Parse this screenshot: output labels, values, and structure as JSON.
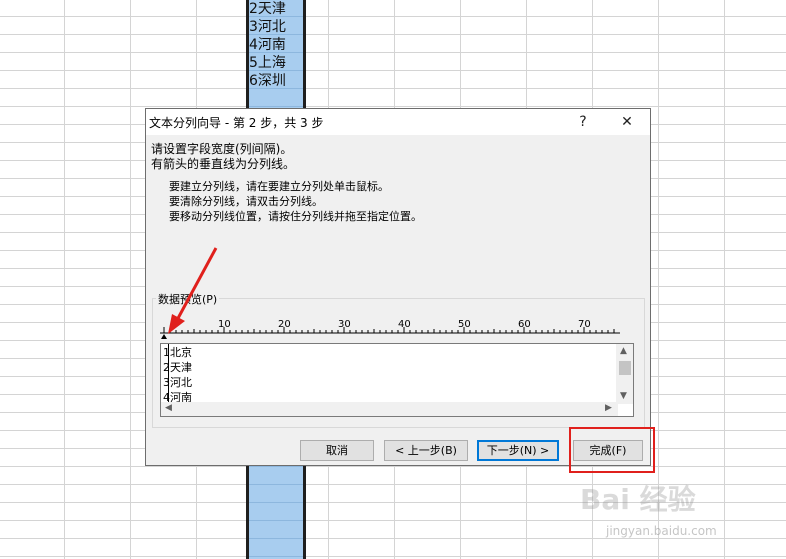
{
  "sheet": {
    "cells": [
      "2天津",
      "3河北",
      "4河南",
      "5上海",
      "6深圳"
    ]
  },
  "dialog": {
    "title": "文本分列向导 - 第 2 步，共 3 步",
    "help_glyph": "?",
    "close_glyph": "✕",
    "line1": "请设置字段宽度(列间隔)。",
    "line2": "有箭头的垂直线为分列线。",
    "instructions": [
      "要建立分列线，请在要建立分列处单击鼠标。",
      "要清除分列线，请双击分列线。",
      "要移动分列线位置，请按住分列线并拖至指定位置。"
    ],
    "preview_label": "数据预览(P)",
    "ruler_ticks": [
      "10",
      "20",
      "30",
      "40",
      "50",
      "60",
      "70"
    ],
    "preview_rows": [
      "1北京",
      "2天津",
      "3河北",
      "4河南"
    ],
    "buttons": {
      "cancel": "取消",
      "back": "< 上一步(B)",
      "next": "下一步(N) >",
      "finish": "完成(F)"
    }
  },
  "watermark": {
    "logo": "Bai 经验",
    "url": "jingyan.baidu.com"
  },
  "colors": {
    "selected_column": "#a8cdef",
    "annotation_red": "#e0201c",
    "default_button_border": "#0078d7"
  }
}
